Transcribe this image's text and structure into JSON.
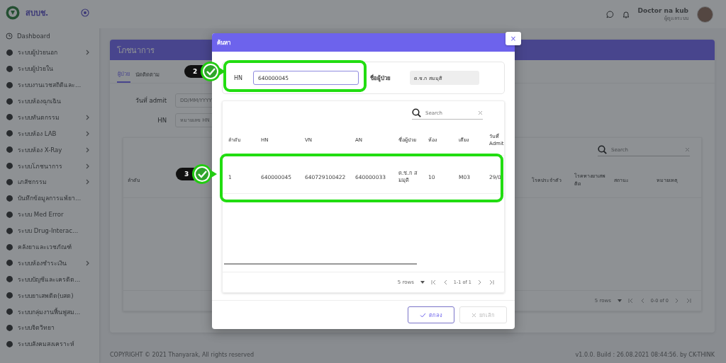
{
  "sidebar": {
    "brand": "สบบช.",
    "items": [
      {
        "label": "Dashboard",
        "kind": "clock",
        "has_submenu": false
      },
      {
        "label": "ระบบผู้ป่วยนอก",
        "kind": "module",
        "has_submenu": true
      },
      {
        "label": "ระบบผู้ป่วยใน",
        "kind": "module",
        "has_submenu": false
      },
      {
        "label": "ระบบงานเวชสถิติและ...",
        "kind": "module",
        "has_submenu": false
      },
      {
        "label": "ระบบห้องฉุกเฉิน",
        "kind": "module",
        "has_submenu": false
      },
      {
        "label": "ระบบทันตกรรม",
        "kind": "module",
        "has_submenu": true
      },
      {
        "label": "ระบบห้อง LAB",
        "kind": "module",
        "has_submenu": true
      },
      {
        "label": "ระบบห้อง X-Ray",
        "kind": "module",
        "has_submenu": true
      },
      {
        "label": "ระบบโภชนาการ",
        "kind": "module",
        "has_submenu": true
      },
      {
        "label": "เภสัชกรรม",
        "kind": "module",
        "has_submenu": true
      },
      {
        "label": "บันทึกข้อมูลการแพ้ยา...",
        "kind": "module",
        "has_submenu": false
      },
      {
        "label": "ระบบ Med Error",
        "kind": "module",
        "has_submenu": false
      },
      {
        "label": "ระบบ Drug-Interac...",
        "kind": "module",
        "has_submenu": false
      },
      {
        "label": "คลังยาและเวชภัณฑ์",
        "kind": "module",
        "has_submenu": false
      },
      {
        "label": "ระบบห้องชำระเงิน",
        "kind": "module",
        "has_submenu": true
      },
      {
        "label": "ระบบบัญชีและเครดิต...",
        "kind": "module",
        "has_submenu": false
      },
      {
        "label": "ระบบยาเสพติด(บสต)",
        "kind": "module",
        "has_submenu": false
      },
      {
        "label": "ระบบกลุ่มงานฟื้นฟูสม...",
        "kind": "module",
        "has_submenu": false
      },
      {
        "label": "ระบบจิตวิทยา",
        "kind": "module",
        "has_submenu": false
      },
      {
        "label": "ระบบสังคมสงเคราะห์",
        "kind": "module",
        "has_submenu": false
      }
    ]
  },
  "header": {
    "user_name": "Doctor na kub",
    "user_role": "ผู้ดูแลระบบ"
  },
  "page": {
    "title": "โภชนาการ",
    "tabs": [
      {
        "label": "ผู้ป่วย",
        "selected": true
      },
      {
        "label": "นัดติดตาม",
        "selected": false
      }
    ],
    "filters": [
      {
        "label": "วันที่ admit",
        "placeholder": "DD/MM/YYYY"
      },
      {
        "label": "HN",
        "placeholder": "หมายเลข HN"
      }
    ],
    "table": {
      "search_placeholder": "Search",
      "columns": [
        "ลำดับ",
        "โรคประจำตัว",
        "โรคทางยาเสพติด",
        "สถานะ",
        "หมายเหตุ"
      ],
      "rows_per_page": "5 rows",
      "range": "0-0 of 0"
    }
  },
  "footer": {
    "copyright": "COPYRIGHT © 2021 Thanyarak, All rights reserved",
    "version": "v1.0.0. Build : 26.08.2021 08:44:56. by CK-THINK"
  },
  "modal": {
    "title": "ค้นหา",
    "close_label": "×",
    "hn_label": "HN",
    "hn_value": "640000045",
    "name_label": "ชื่อผู้ป่วย",
    "name_value": "ด.ช.ก สมมุติ",
    "table": {
      "search_placeholder": "Search",
      "columns": [
        "ลำดับ",
        "HN",
        "VN",
        "AN",
        "ชื่อผู้ป่วย",
        "ห้อง",
        "เตียง",
        "วันที่ Admit"
      ],
      "rows": [
        [
          "1",
          "640000045",
          "640729100422",
          "640000033",
          "ด.ช.ก สมมุติ",
          "10",
          "M03",
          "29/0"
        ]
      ],
      "rows_per_page": "5 rows",
      "range": "1-1 of 1"
    },
    "buttons": [
      {
        "label": "ตกลง",
        "kind": "confirm",
        "disabled": false
      },
      {
        "label": "ยกเลิก",
        "kind": "cancel",
        "disabled": true
      }
    ]
  },
  "annotations": [
    {
      "number": "2"
    },
    {
      "number": "3"
    }
  ]
}
